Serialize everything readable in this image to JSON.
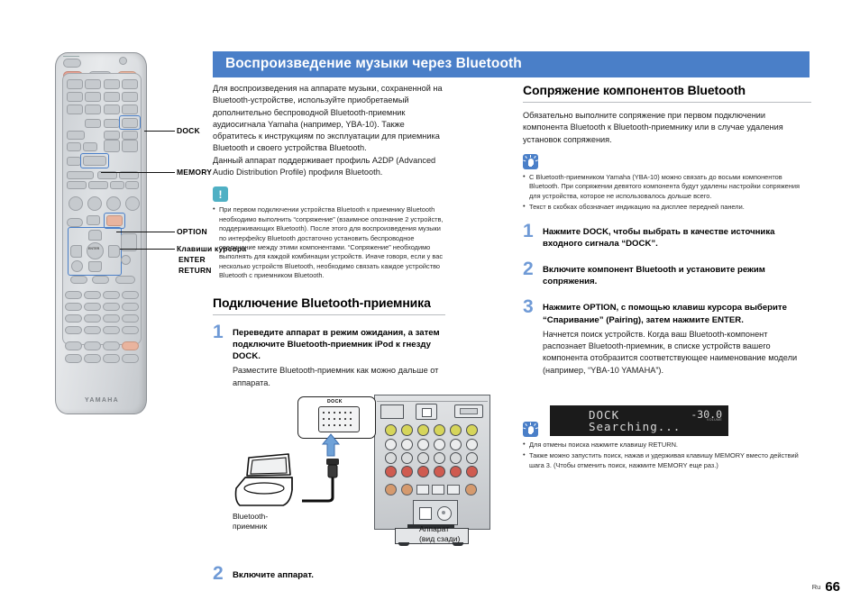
{
  "header": {
    "title": "Воспроизведение музыки через Bluetooth"
  },
  "left_column": {
    "intro_paragraphs": [
      "Для воспроизведения на аппарате музыки, сохраненной на Bluetooth-устройстве, используйте приобретаемый дополнительно беспроводной Bluetooth-приемник аудиосигнала Yamaha (например, YBA-10). Также обратитесь к инструкциям по эксплуатации для приемника Bluetooth и своего устройства Bluetooth.",
      "Данный аппарат поддерживает профиль A2DP (Advanced Audio Distribution Profile) профиля Bluetooth."
    ],
    "note_icon": "exclamation-note-icon",
    "note_symbol": "!",
    "notes": [
      "При первом подключении устройства Bluetooth к приемнику Bluetooth необходимо выполнить “сопряжение” (взаимное опознание 2 устройств, поддерживающих Bluetooth). После этого для воспроизведения музыки по интерфейсу Bluetooth достаточно установить беспроводное соединение между этими компонентами. “Сопряжение” необходимо выполнять для каждой комбинации устройств. Иначе говоря, если у вас несколько устройств Bluetooth, необходимо связать каждое устройство Bluetooth с приемником Bluetooth."
    ],
    "section_title": "Подключение Bluetooth-приемника",
    "steps": [
      {
        "number": "1",
        "title": "Переведите аппарат в режим ожидания, а затем подключите Bluetooth-приемник iPod к гнезду DOCK.",
        "detail": "Разместите Bluetooth-приемник как можно дальше от аппарата."
      },
      {
        "number": "2",
        "title": "Включите аппарат.",
        "detail": ""
      }
    ],
    "diagram": {
      "dock_label": "DOCK",
      "receiver_label_line1": "Bluetooth-",
      "receiver_label_line2": "приемник",
      "unit_label_line1": "Аппарат",
      "unit_label_line2": "(вид сзади)"
    }
  },
  "right_column": {
    "section_title": "Сопряжение компонентов Bluetooth",
    "intro": "Обязательно выполните сопряжение при первом подключении компонента Bluetooth к Bluetooth-приемнику или в случае удаления установок сопряжения.",
    "tip_icon_1": "lightbulb-tip-icon",
    "tips_1": [
      "С Bluetooth-приемником Yamaha (YBA-10) можно связать до восьми компонентов Bluetooth. При сопряжении девятого компонента будут удалены настройки сопряжения для устройства, которое не использовалось дольше всего.",
      "Текст в скобках обозначает индикацию на дисплее передней панели."
    ],
    "steps": [
      {
        "number": "1",
        "title": "Нажмите DOCK, чтобы выбрать в качестве источника входного сигнала “DOCK”.",
        "detail": ""
      },
      {
        "number": "2",
        "title": "Включите компонент Bluetooth и установите режим сопряжения.",
        "detail": ""
      },
      {
        "number": "3",
        "title": "Нажмите OPTION, с помощью клавиш курсора выберите “Спаривание” (Pairing), затем нажмите ENTER.",
        "detail": "Начнется поиск устройств. Когда ваш Bluetooth-компонент распознает Bluetooth-приемник, в списке устройств вашего компонента отобразится соответствующее наименование модели (например, “YBA-10 YAMAHA”)."
      }
    ],
    "display_panel": {
      "line1": "DOCK",
      "line2": "Searching...",
      "volume": "-30.0",
      "volume_unit": "dB",
      "volume_tag": "VOLUME"
    },
    "tip_icon_2": "lightbulb-tip-icon",
    "tips_2": [
      "Для отмены поиска нажмите клавишу RETURN.",
      "Также можно запустить поиск, нажав и удерживая клавишу MEMORY вместо действий шага 3. (Чтобы отменить поиск, нажмите MEMORY еще раз.)"
    ]
  },
  "remote": {
    "callouts": [
      {
        "label": "DOCK"
      },
      {
        "label": "MEMORY"
      },
      {
        "label": "OPTION"
      },
      {
        "label": "Клавиши курсора"
      },
      {
        "label": "ENTER"
      },
      {
        "label": "RETURN"
      }
    ],
    "brand": "YAMAHA",
    "enter_label": "ENTER"
  },
  "footer": {
    "lang": "Ru",
    "page_number": "66"
  },
  "colors": {
    "header_bar": "#4a7fc8",
    "step_number": "#6f9ad6",
    "note_icon": "#4fb0c4",
    "tip_icon": "#4a7fc8",
    "highlight_box": "#4a7fc8"
  }
}
